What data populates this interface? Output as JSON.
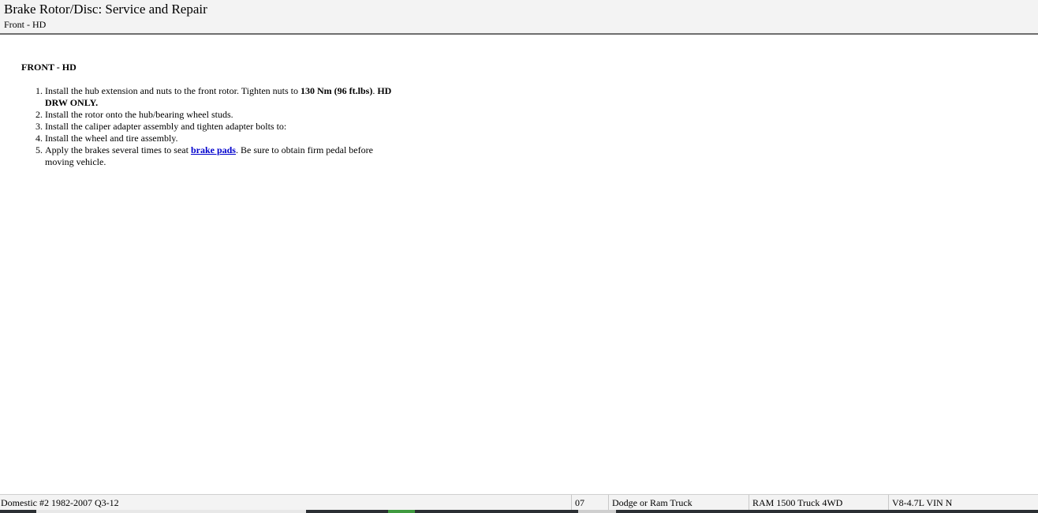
{
  "header": {
    "title": "Brake Rotor/Disc:  Service and Repair",
    "subtitle": "Front - HD"
  },
  "content": {
    "heading": "FRONT - HD",
    "steps": [
      {
        "text_a": "Install the hub extension and nuts to the front rotor. Tighten nuts to ",
        "bold_a": "130 Nm (96 ft.lbs)",
        "text_b": ". ",
        "bold_b": "HD DRW ONLY."
      },
      {
        "text": "Install the rotor onto the hub/bearing wheel studs."
      },
      {
        "text": "Install the caliper adapter assembly and tighten adapter bolts to:"
      },
      {
        "text": "Install the wheel and tire assembly."
      },
      {
        "text_a": "Apply the brakes several times to seat ",
        "link": "brake pads",
        "text_b": ". Be sure to obtain firm pedal before moving vehicle."
      }
    ]
  },
  "statusbar": {
    "database": "Domestic #2 1982-2007 Q3-12",
    "year": "07",
    "make": "Dodge or Ram Truck",
    "model": "RAM 1500 Truck 4WD",
    "engine": "V8-4.7L VIN N"
  },
  "colors": {
    "link": "#0000cc",
    "header_bg": "#f3f3f3",
    "header_rule": "#6e6e6e"
  }
}
